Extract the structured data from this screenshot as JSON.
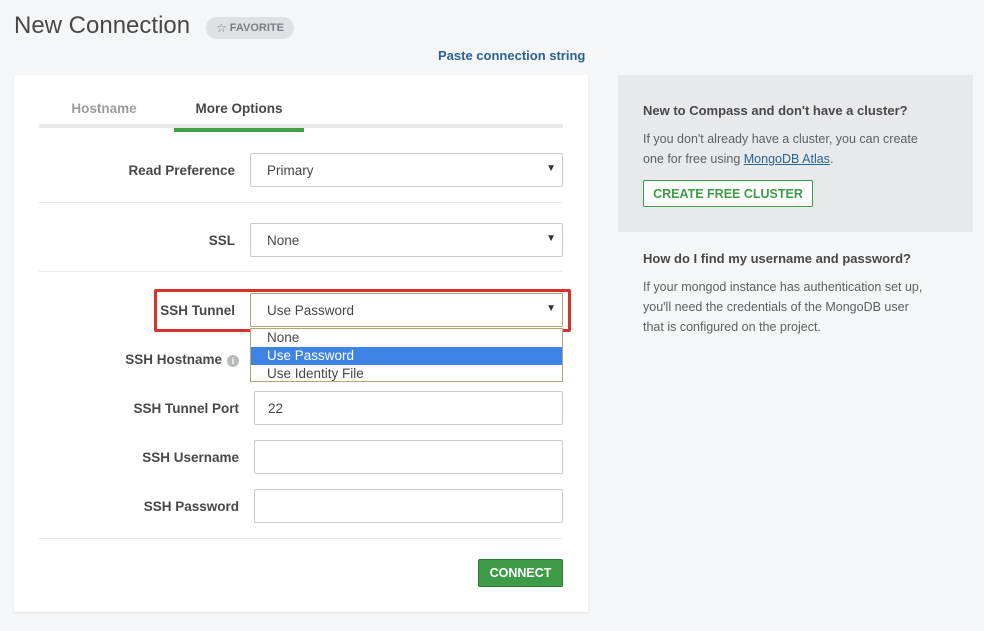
{
  "header": {
    "title": "New Connection",
    "favorite_label": "FAVORITE",
    "paste_link": "Paste connection string"
  },
  "tabs": [
    {
      "label": "Hostname",
      "active": false
    },
    {
      "label": "More Options",
      "active": true
    }
  ],
  "form": {
    "read_preference": {
      "label": "Read Preference",
      "value": "Primary"
    },
    "ssl": {
      "label": "SSL",
      "value": "None"
    },
    "ssh_tunnel": {
      "label": "SSH Tunnel",
      "value": "Use Password",
      "options": [
        "None",
        "Use Password",
        "Use Identity File"
      ]
    },
    "ssh_hostname": {
      "label": "SSH Hostname",
      "value": ""
    },
    "ssh_tunnel_port": {
      "label": "SSH Tunnel Port",
      "value": "22"
    },
    "ssh_username": {
      "label": "SSH Username",
      "value": ""
    },
    "ssh_password": {
      "label": "SSH Password",
      "value": ""
    },
    "connect_label": "CONNECT"
  },
  "help": {
    "cluster_heading": "New to Compass and don't have a cluster?",
    "cluster_text_1": "If you don't already have a cluster, you can create",
    "cluster_text_2": "one for free using ",
    "atlas_link": "MongoDB Atlas",
    "cluster_text_3": ".",
    "create_cluster_label": "CREATE FREE CLUSTER",
    "creds_heading": "How do I find my username and password?",
    "creds_text_1": "If your mongod instance has authentication set up,",
    "creds_text_2": "you'll need the credentials of the MongoDB user",
    "creds_text_3": "that is configured on the project."
  },
  "colors": {
    "accent_green": "#43a047",
    "link_blue": "#2a6394",
    "highlight_red": "#d5322e",
    "option_selected": "#3f84e5"
  }
}
